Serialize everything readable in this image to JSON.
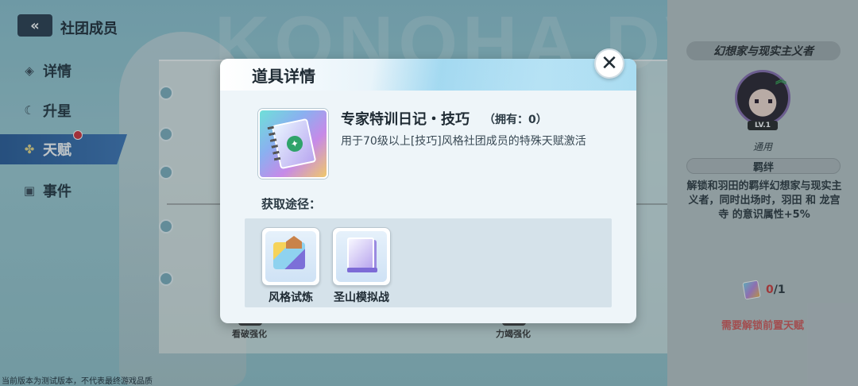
{
  "header": {
    "back_icon": "«",
    "title": "社团成员"
  },
  "background": {
    "watermark_text": "KONOHA DV"
  },
  "sidebar": {
    "items": [
      {
        "label": "详情",
        "icon": "cube-icon"
      },
      {
        "label": "升星",
        "icon": "moon-icon"
      },
      {
        "label": "天赋",
        "icon": "sparkle-icon",
        "active": true,
        "has_notification": true
      },
      {
        "label": "事件",
        "icon": "card-icon"
      }
    ]
  },
  "tree": {
    "nodes": [
      {
        "label": "看破强化"
      },
      {
        "label": "力竭强化"
      }
    ]
  },
  "right_panel": {
    "title": "幻想家与现实主义者",
    "level": "LV.1",
    "general": "通用",
    "bond_label": "羁绊",
    "description": "解锁和羽田的羁绊幻想家与现实主义者，同时出场时，羽田 和 龙宫寺 的意识属性+5%",
    "owned": "0",
    "needed": "/1",
    "warning": "需要解锁前置天赋"
  },
  "modal": {
    "title": "道具详情",
    "close_icon": "✕",
    "item_name": "专家特训日记・技巧",
    "item_owned": "（拥有：0）",
    "item_description": "用于70级以上[技巧]风格社团成员的特殊天赋激活",
    "source_label": "获取途径：",
    "sources": [
      {
        "label": "风格试炼",
        "icon": "gift-house-icon"
      },
      {
        "label": "圣山模拟战",
        "icon": "purple-card-icon"
      }
    ]
  },
  "footer": {
    "notice": "当前版本为测试版本，不代表最终游戏品质"
  },
  "colors": {
    "accent_blue": "#2b5d9a",
    "notification_red": "#d6333c",
    "warning_red": "#d65a5a"
  }
}
